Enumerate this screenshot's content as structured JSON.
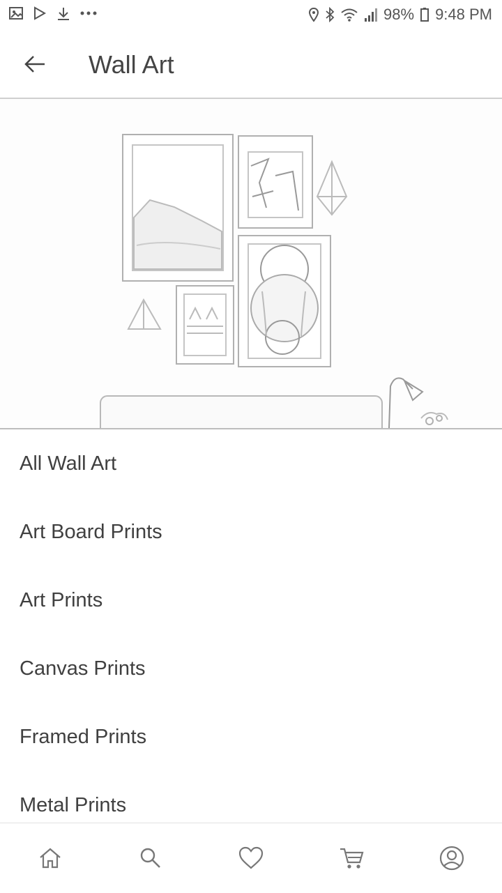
{
  "status_bar": {
    "battery_percent": "98%",
    "time": "9:48 PM",
    "left_icons": [
      "gallery-icon",
      "play-store-icon",
      "download-icon",
      "more-dots-icon"
    ],
    "right_icons": [
      "location-icon",
      "bluetooth-icon",
      "wifi-icon",
      "signal-icon",
      "battery-icon"
    ]
  },
  "app_bar": {
    "title": "Wall Art"
  },
  "menu": {
    "items": [
      {
        "label": "All Wall Art"
      },
      {
        "label": "Art Board Prints"
      },
      {
        "label": "Art Prints"
      },
      {
        "label": "Canvas Prints"
      },
      {
        "label": "Framed Prints"
      },
      {
        "label": "Metal Prints"
      }
    ]
  },
  "bottom_nav": {
    "items": [
      "home-icon",
      "search-icon",
      "heart-icon",
      "cart-icon",
      "account-icon"
    ]
  }
}
